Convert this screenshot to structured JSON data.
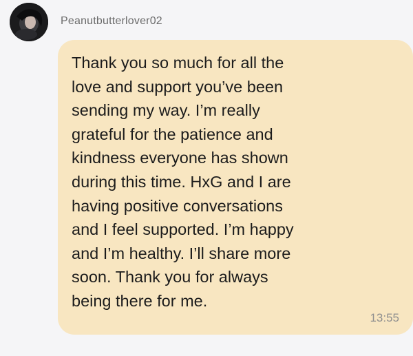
{
  "sender": {
    "username": "Peanutbutterlover02",
    "avatar_icon": "user-avatar-photo"
  },
  "message": {
    "text": "Thank you so much for all the\nlove and support you’ve been\nsending my way. I’m really\ngrateful for the patience and\nkindness everyone has shown\nduring this time.  HxG and I are\nhaving positive conversations\nand I feel supported. I’m happy\nand I’m healthy.  I’ll share more\nsoon. Thank you for always\nbeing there for me.",
    "time": "13:55"
  },
  "colors": {
    "bubble": "#f8e6c1",
    "background": "#f5f5f7"
  }
}
